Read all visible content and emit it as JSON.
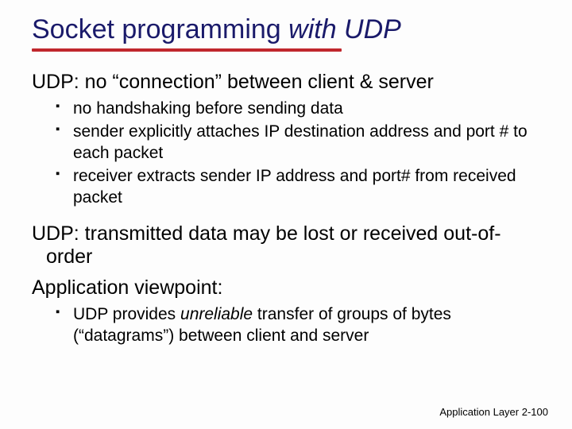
{
  "title_a": "Socket programming ",
  "title_b": "with UDP",
  "sub1": "UDP: no “connection” between client & server",
  "bullets1": {
    "b0": "no handshaking before sending data",
    "b1": "sender explicitly attaches IP destination address and port # to each packet",
    "b2": "receiver extracts sender IP address and port# from received packet"
  },
  "sub2": "UDP: transmitted data may be lost or received out-of-order",
  "sub3": "Application viewpoint:",
  "bullets2": {
    "b0_a": "UDP provides ",
    "b0_b": "unreliable",
    "b0_c": " transfer  of groups of bytes (“datagrams”)  between client and server"
  },
  "footer_label": "Application Layer",
  "footer_page": "2-100"
}
